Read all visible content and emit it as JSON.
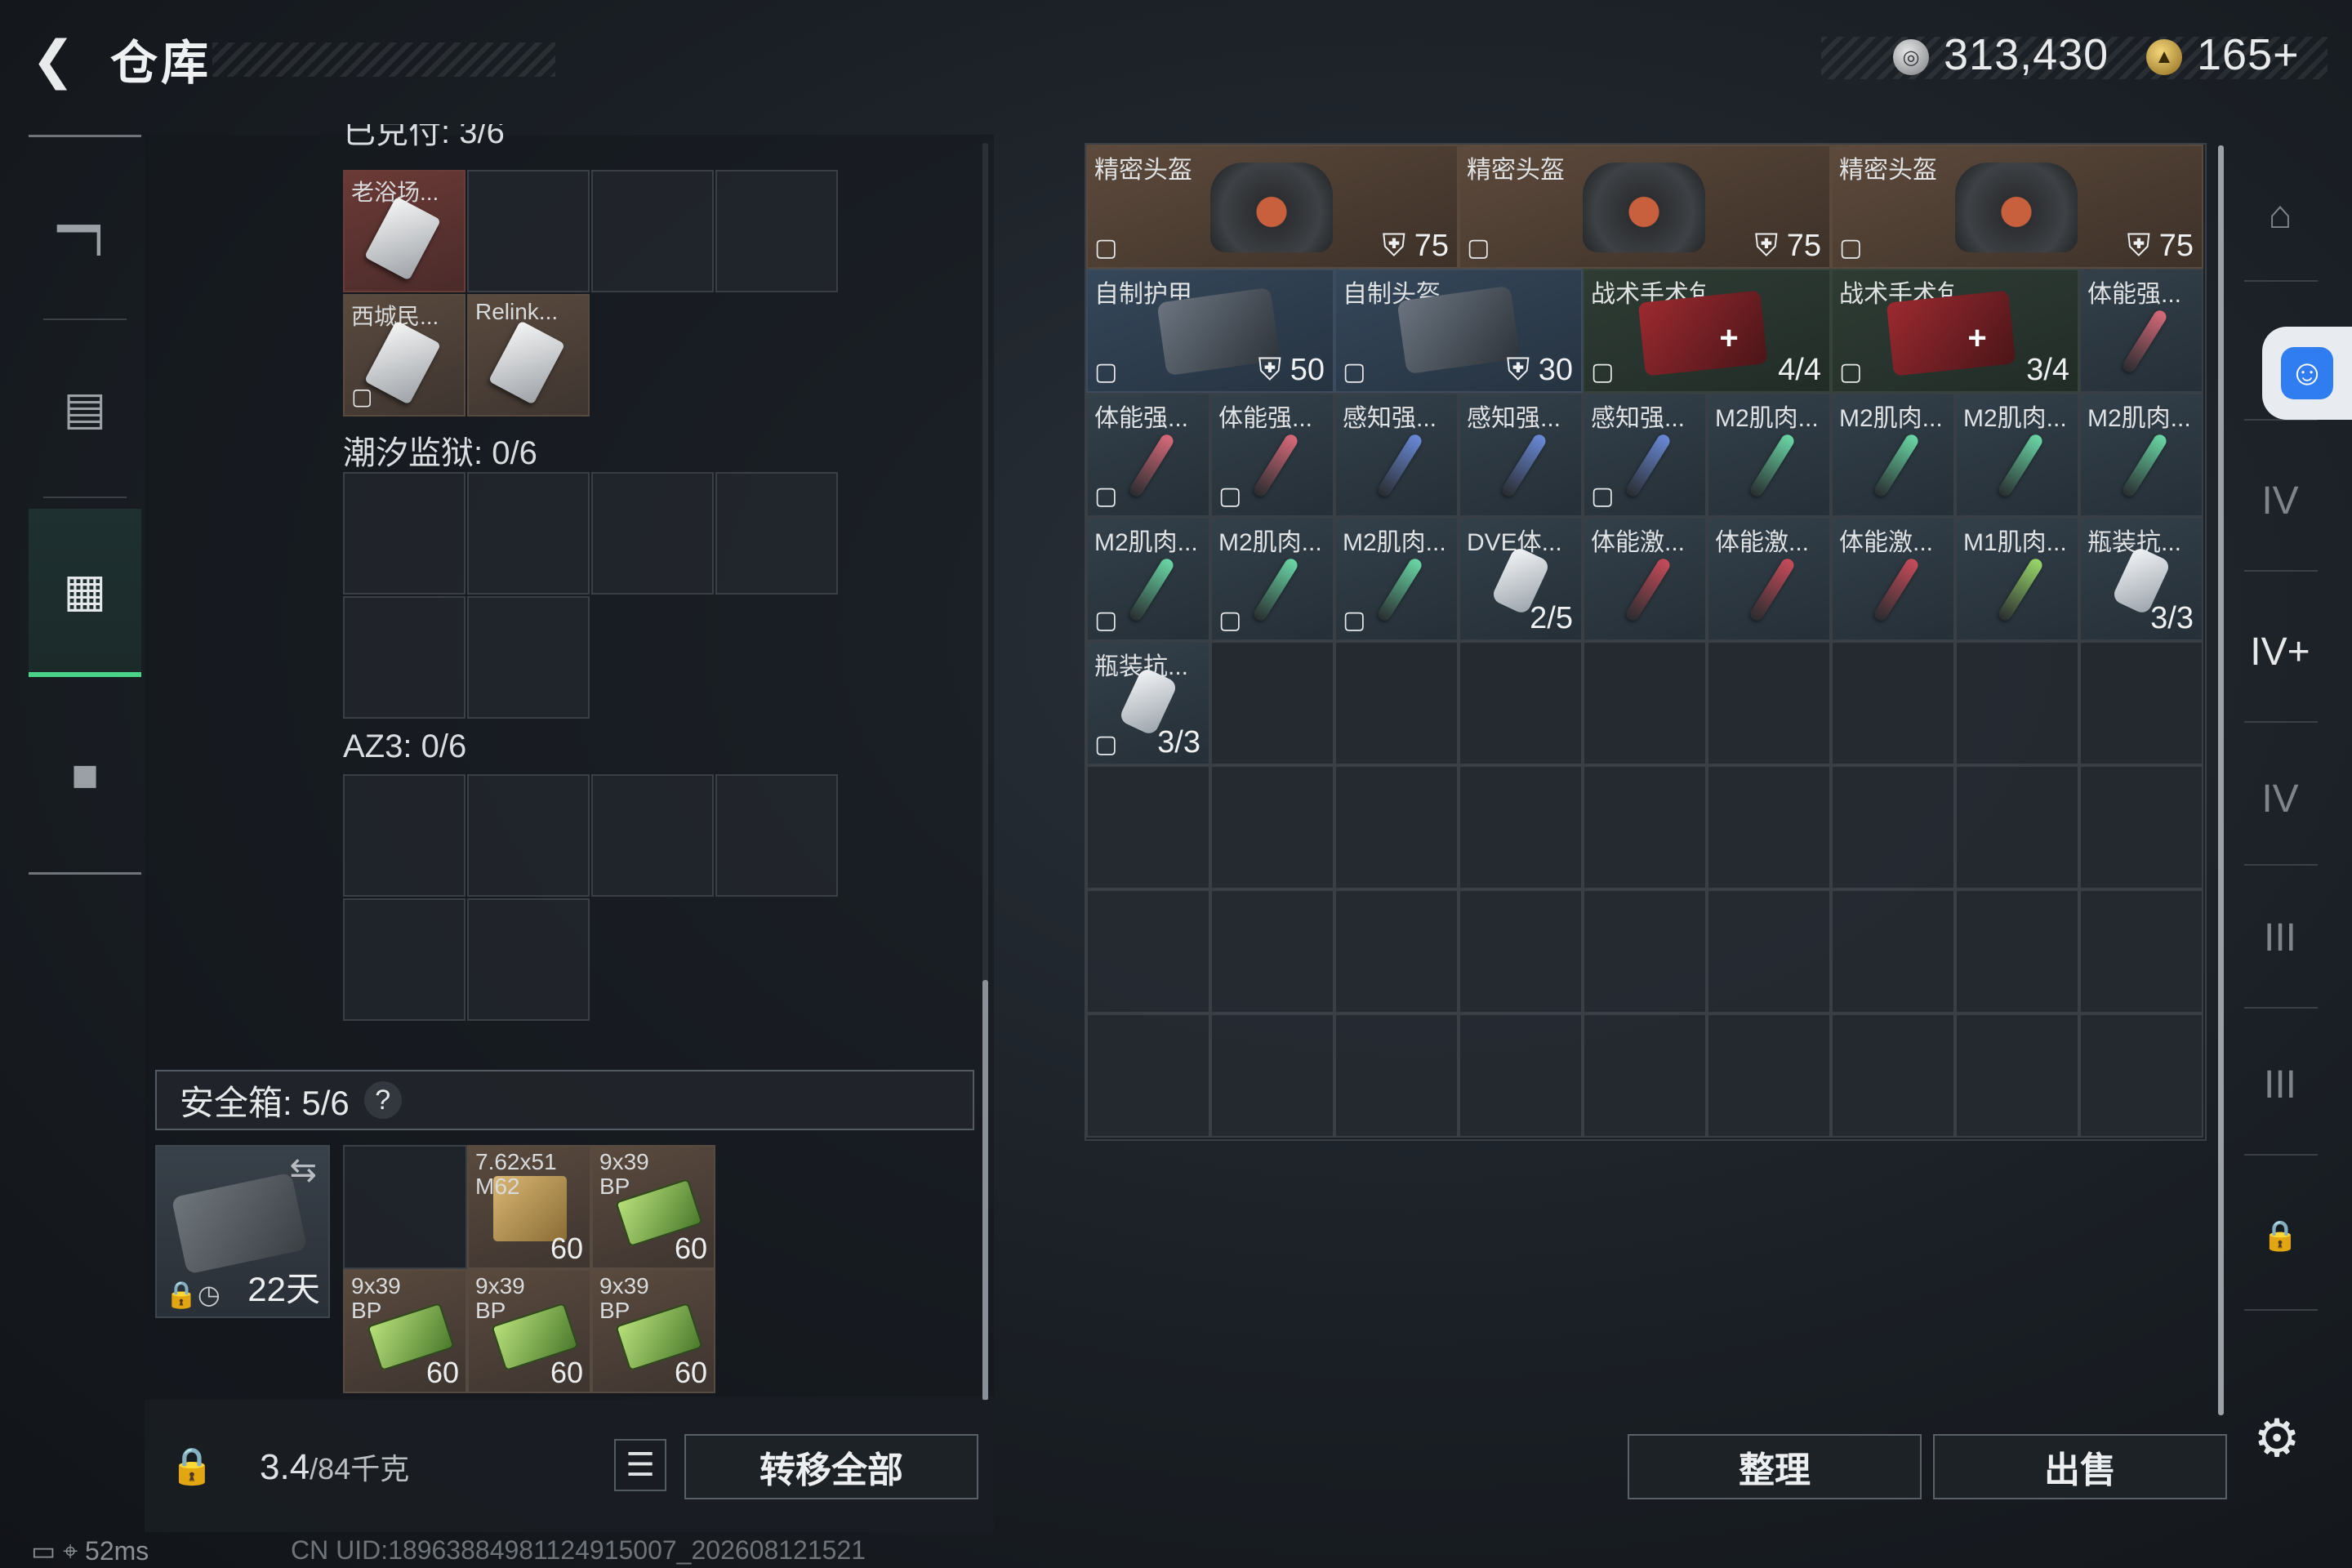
{
  "header": {
    "back_icon": "back-arrow-icon",
    "title": "仓库"
  },
  "currency": {
    "silver": "313,430",
    "gold": "165+"
  },
  "left_sections": [
    {
      "label": "已兑付: 3/6"
    },
    {
      "label": "潮汐监狱: 0/6"
    },
    {
      "label": "AZ3: 0/6"
    }
  ],
  "cards": [
    {
      "name": "老浴场..."
    },
    {
      "name": "西城民..."
    },
    {
      "name": "Relink..."
    }
  ],
  "safe_box": {
    "label": "安全箱: 5/6",
    "help": "?",
    "days": "22天",
    "items": [
      {
        "name": "7.62x51 M62",
        "qty": "60"
      },
      {
        "name": "9x39 BP",
        "qty": "60"
      },
      {
        "name": "9x39 BP",
        "qty": "60"
      },
      {
        "name": "9x39 BP",
        "qty": "60"
      },
      {
        "name": "9x39 BP",
        "qty": "60"
      }
    ]
  },
  "footer_left": {
    "weight": "3.4",
    "weight_max": "/84千克",
    "transfer_all": "转移全部"
  },
  "footer_right": {
    "sort": "整理",
    "sell": "出售"
  },
  "stash": {
    "helmets": [
      {
        "name": "精密头盔",
        "armor": "75"
      },
      {
        "name": "精密头盔",
        "armor": "75"
      },
      {
        "name": "精密头盔",
        "armor": "75"
      }
    ],
    "row2": [
      {
        "name": "自制护甲...",
        "qty": "50"
      },
      {
        "name": "自制头盔...",
        "qty": "30"
      },
      {
        "name": "战术手术包",
        "qty": "4/4"
      },
      {
        "name": "战术手术包",
        "qty": "3/4"
      },
      {
        "name": "体能强..."
      }
    ],
    "row3": [
      {
        "name": "体能强..."
      },
      {
        "name": "体能强..."
      },
      {
        "name": "感知强..."
      },
      {
        "name": "感知强..."
      },
      {
        "name": "感知强..."
      },
      {
        "name": "M2肌肉..."
      },
      {
        "name": "M2肌肉..."
      },
      {
        "name": "M2肌肉..."
      },
      {
        "name": "M2肌肉..."
      }
    ],
    "row4": [
      {
        "name": "M2肌肉..."
      },
      {
        "name": "M2肌肉..."
      },
      {
        "name": "M2肌肉..."
      },
      {
        "name": "DVE体...",
        "qty": "2/5"
      },
      {
        "name": "体能激..."
      },
      {
        "name": "体能激..."
      },
      {
        "name": "体能激..."
      },
      {
        "name": "M1肌肉..."
      },
      {
        "name": "瓶装抗...",
        "qty": "3/3"
      }
    ],
    "row5": [
      {
        "name": "瓶装抗...",
        "qty": "3/3"
      }
    ]
  },
  "status": {
    "ping": "52ms",
    "uid": "CN UID:18963884981124915007_202608121521"
  },
  "colors": {
    "accent_green": "#4bd38a",
    "access_blue": "#2f7df0"
  }
}
